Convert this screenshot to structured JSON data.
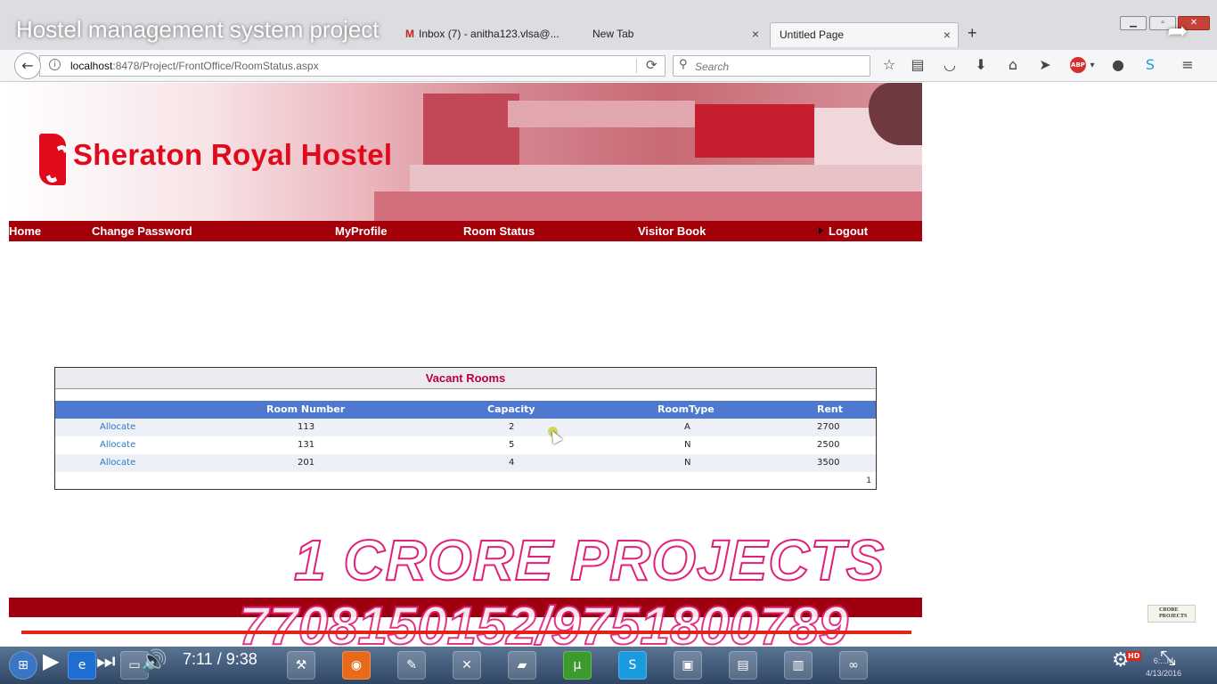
{
  "video": {
    "title": "Hostel management system project",
    "current_time": "7:11",
    "duration": "9:38",
    "time_separator": " / ",
    "progress_fraction": 0.758,
    "quality_badge": "HD",
    "watermark_line1": "1 CRORE PROJECTS",
    "watermark_line2": "7708150152/9751800789",
    "corner_logo": "CRORE PROJECTS"
  },
  "browser": {
    "tabs": [
      {
        "label": "Inbox (7) - anitha123.vlsa@...",
        "icon": "gmail-icon"
      },
      {
        "label": "New Tab"
      },
      {
        "label": "Untitled Page",
        "active": true
      }
    ],
    "tab_close_glyph": "×",
    "url_host": "localhost",
    "url_rest": ":8478/Project/FrontOffice/RoomStatus.aspx",
    "search_placeholder": "Search",
    "abp_label": "ABP"
  },
  "site": {
    "brand": "Sheraton Royal Hostel",
    "menu": {
      "home": "Home",
      "change_password": "Change Password",
      "my_profile": "MyProfile",
      "room_status": "Room Status",
      "visitor_book": "Visitor Book",
      "logout": "Logout"
    }
  },
  "vacant_rooms": {
    "caption": "Vacant Rooms",
    "columns": [
      "Room Number",
      "Capacity",
      "RoomType",
      "Rent"
    ],
    "action_label": "Allocate",
    "rows": [
      {
        "room_number": "113",
        "capacity": "2",
        "room_type": "A",
        "rent": "2700"
      },
      {
        "room_number": "131",
        "capacity": "5",
        "room_type": "N",
        "rent": "2500"
      },
      {
        "room_number": "201",
        "capacity": "4",
        "room_type": "N",
        "rent": "3500"
      }
    ],
    "page": "1"
  },
  "taskbar": {
    "clock_time": "6:...M",
    "clock_date": "4/13/2016"
  },
  "colors": {
    "brand_red": "#e00a1c",
    "menu_bar": "#a4000a",
    "grid_header": "#4e79cf",
    "caption_text": "#b8003c",
    "link": "#2a78c2",
    "youtube_red": "#e62117"
  }
}
